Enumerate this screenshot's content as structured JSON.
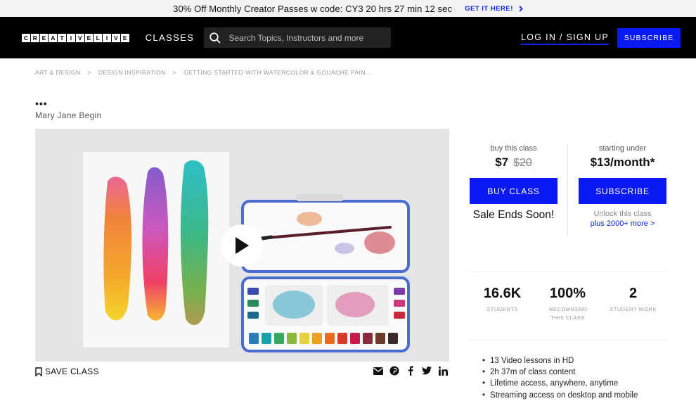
{
  "promo": {
    "text": "30% Off Monthly Creator Passes w code: CY3 20 hrs 27 min 12 sec",
    "cta": "GET IT HERE!"
  },
  "nav": {
    "logo_letters": [
      "C",
      "R",
      "E",
      "A",
      "T",
      "I",
      "V",
      "E",
      "L",
      "I",
      "V",
      "E"
    ],
    "classes": "CLASSES",
    "search_placeholder": "Search Topics, Instructors and more",
    "login": "LOG IN / SIGN UP",
    "subscribe": "SUBSCRIBE"
  },
  "breadcrumb": [
    "ART & DESIGN",
    ">",
    "DESIGN INSPIRATION",
    ">",
    "GETTING STARTED WITH WATERCOLOR & GOUACHE PAIN..."
  ],
  "course": {
    "dots": "•••",
    "instructor": "Mary Jane Begin"
  },
  "actions": {
    "save": "SAVE CLASS"
  },
  "buy": {
    "label": "buy this class",
    "price": "$7",
    "old_price": "$20",
    "button": "BUY CLASS",
    "sale": "Sale Ends Soon!"
  },
  "subscribe": {
    "label": "starting under",
    "price": "$13/month*",
    "button": "SUBSCRIBE",
    "unlock": "Unlock this class",
    "more": "plus 2000+ more >"
  },
  "stats": [
    {
      "num": "16.6K",
      "cap": "STUDENTS"
    },
    {
      "num": "100%",
      "cap": "RECOMMEND THIS CLASS"
    },
    {
      "num": "2",
      "cap": "STUDENT WORK"
    }
  ],
  "features": [
    "13 Video lessons in HD",
    "2h 37m of class content",
    "Lifetime access, anywhere, anytime",
    "Streaming access on desktop and mobile"
  ],
  "colors": {
    "accent": "#0a1af5",
    "nav_bg": "#000000"
  },
  "icons": [
    "search-icon",
    "chevron-right-icon",
    "play-icon",
    "bookmark-icon",
    "email-icon",
    "pinterest-icon",
    "facebook-icon",
    "twitter-icon",
    "linkedin-icon"
  ]
}
